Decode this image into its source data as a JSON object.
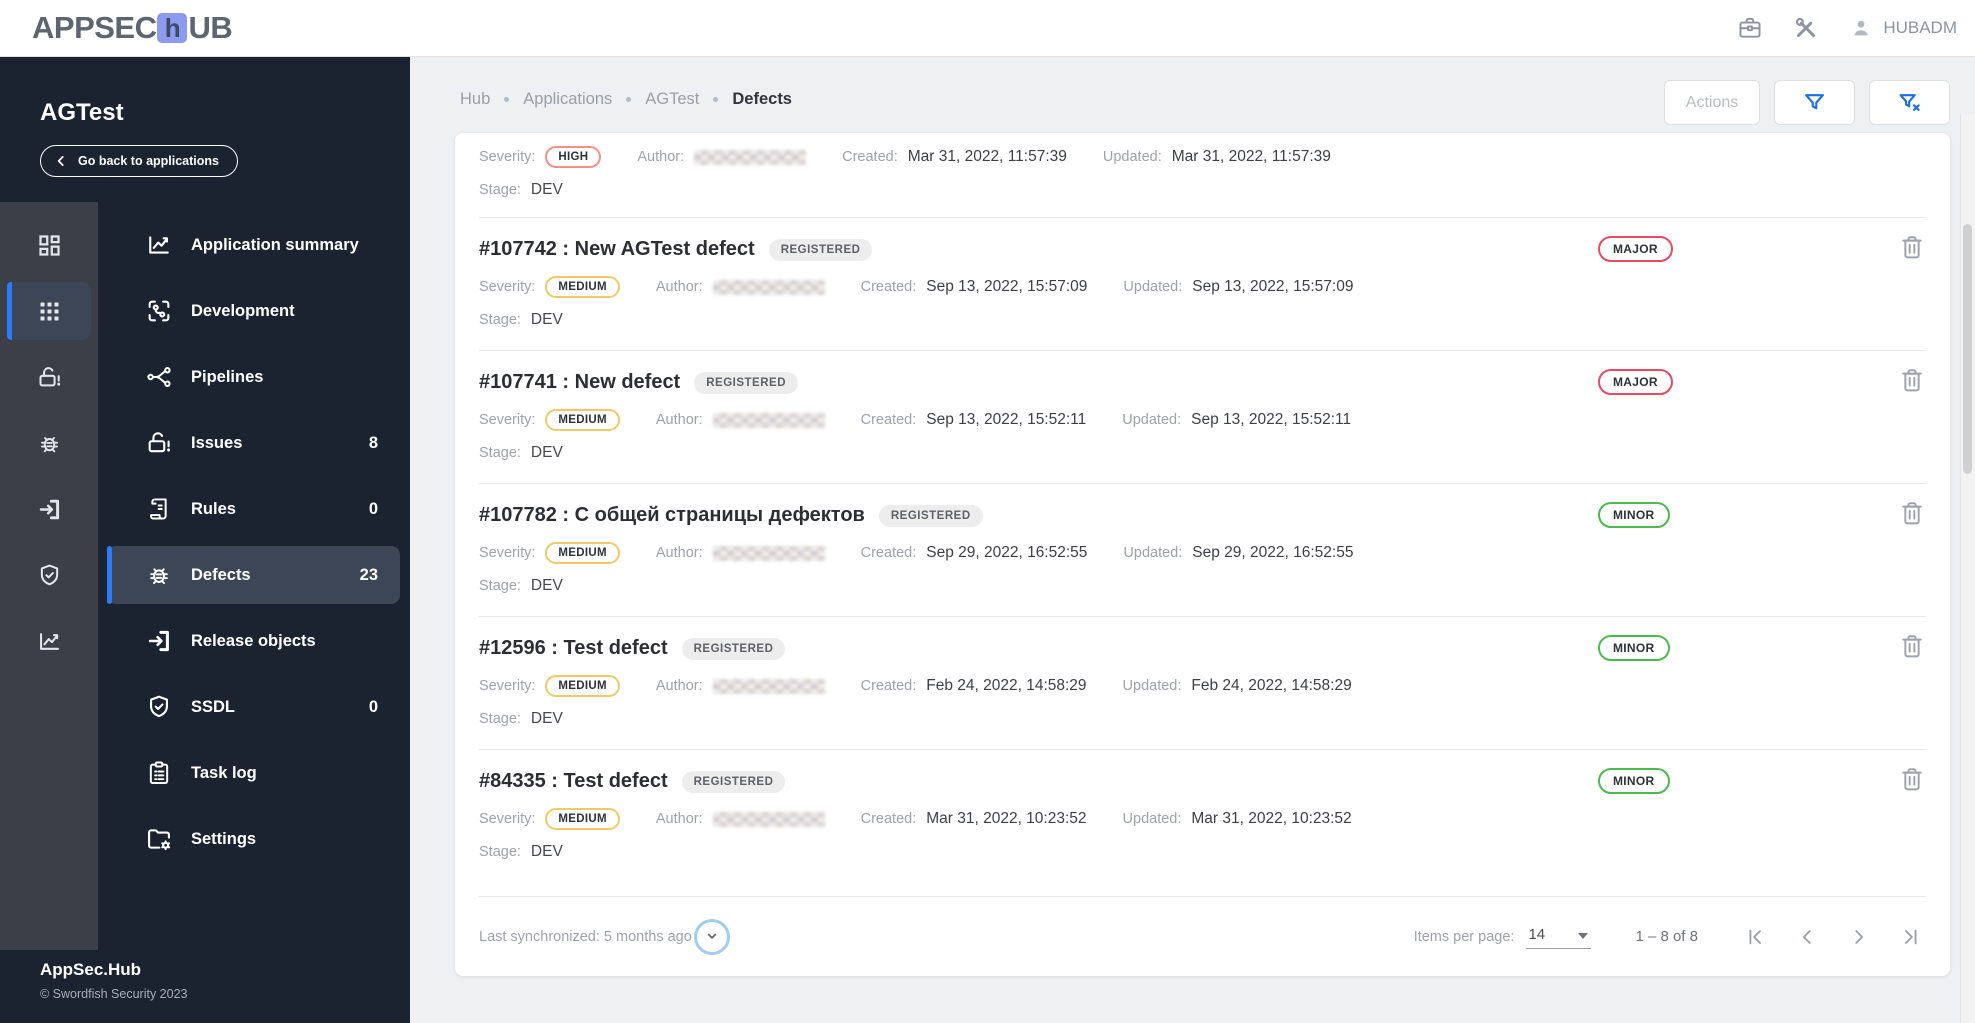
{
  "topbar": {
    "logo_pre": "APPSEC",
    "logo_h": "h",
    "logo_post": "UB",
    "username": "HUBADM"
  },
  "sidebar": {
    "app_name": "AGTest",
    "back_label": "Go back to applications",
    "rail_items": [
      {
        "icon": "dashboard",
        "active": false
      },
      {
        "icon": "grid",
        "active": true
      },
      {
        "icon": "lock-alert",
        "active": false
      },
      {
        "icon": "bug",
        "active": false
      },
      {
        "icon": "exit",
        "active": false
      },
      {
        "icon": "shield-check",
        "active": false
      },
      {
        "icon": "chart-line",
        "active": false
      }
    ],
    "menu_items": [
      {
        "label": "Application summary",
        "icon": "chart-line",
        "count": "",
        "active": false
      },
      {
        "label": "Development",
        "icon": "development",
        "count": "",
        "active": false
      },
      {
        "label": "Pipelines",
        "icon": "pipelines",
        "count": "",
        "active": false
      },
      {
        "label": "Issues",
        "icon": "lock-alert",
        "count": "8",
        "active": false
      },
      {
        "label": "Rules",
        "icon": "rules",
        "count": "0",
        "active": false
      },
      {
        "label": "Defects",
        "icon": "bug",
        "count": "23",
        "active": true
      },
      {
        "label": "Release objects",
        "icon": "exit",
        "count": "",
        "active": false
      },
      {
        "label": "SSDL",
        "icon": "shield-check",
        "count": "0",
        "active": false
      },
      {
        "label": "Task log",
        "icon": "task-log",
        "count": "",
        "active": false
      },
      {
        "label": "Settings",
        "icon": "settings",
        "count": "",
        "active": false
      }
    ],
    "footer_title": "AppSec.Hub",
    "footer_copyright": "© Swordfish Security 2023"
  },
  "breadcrumbs": [
    "Hub",
    "Applications",
    "AGTest",
    "Defects"
  ],
  "header": {
    "actions_label": "Actions"
  },
  "defects": {
    "labels": {
      "severity": "Severity:",
      "author": "Author:",
      "created": "Created:",
      "updated": "Updated:",
      "stage": "Stage:"
    },
    "partial_row": {
      "severity": "HIGH",
      "created": "Mar 31, 2022, 11:57:39",
      "updated": "Mar 31, 2022, 11:57:39",
      "stage": "DEV"
    },
    "rows": [
      {
        "title": "#107742 : New AGTest defect",
        "status": "REGISTERED",
        "severity": "MEDIUM",
        "created": "Sep 13, 2022, 15:57:09",
        "updated": "Sep 13, 2022, 15:57:09",
        "stage": "DEV",
        "priority": "MAJOR"
      },
      {
        "title": "#107741 : New defect",
        "status": "REGISTERED",
        "severity": "MEDIUM",
        "created": "Sep 13, 2022, 15:52:11",
        "updated": "Sep 13, 2022, 15:52:11",
        "stage": "DEV",
        "priority": "MAJOR"
      },
      {
        "title": "#107782 : С общей страницы дефектов",
        "status": "REGISTERED",
        "severity": "MEDIUM",
        "created": "Sep 29, 2022, 16:52:55",
        "updated": "Sep 29, 2022, 16:52:55",
        "stage": "DEV",
        "priority": "MINOR"
      },
      {
        "title": "#12596 : Test defect",
        "status": "REGISTERED",
        "severity": "MEDIUM",
        "created": "Feb 24, 2022, 14:58:29",
        "updated": "Feb 24, 2022, 14:58:29",
        "stage": "DEV",
        "priority": "MINOR"
      },
      {
        "title": "#84335 : Test defect",
        "status": "REGISTERED",
        "severity": "MEDIUM",
        "created": "Mar 31, 2022, 10:23:52",
        "updated": "Mar 31, 2022, 10:23:52",
        "stage": "DEV",
        "priority": "MINOR"
      }
    ]
  },
  "list_footer": {
    "last_sync": "Last synchronized: 5 months ago",
    "items_per_page_label": "Items per page:",
    "items_per_page_value": "14",
    "range": "1 – 8 of 8"
  },
  "colors": {
    "accent_blue": "#2e7bf6",
    "sidebar_bg": "#1b2331",
    "rail_bg": "#3a3f48",
    "active_item_bg": "#3d4656",
    "logo_badge": "#8c9bee",
    "severity_high": "#f2918a",
    "severity_medium": "#f3c869",
    "priority_major": "#e84a63",
    "priority_minor": "#4cbb4f",
    "filter_icon_blue": "#1e6fe8",
    "registered_bg": "#ededee"
  }
}
